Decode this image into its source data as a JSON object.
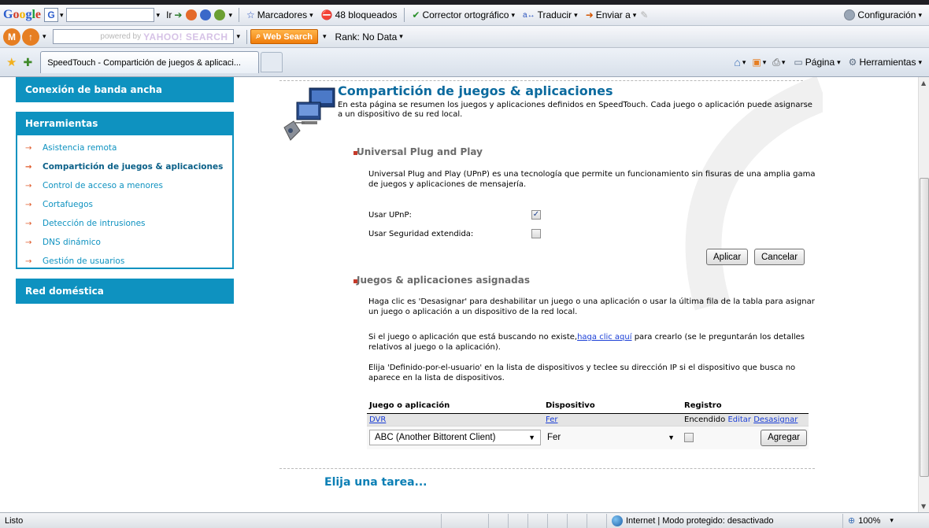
{
  "toolbar_google": {
    "logo": "Google",
    "go_label": "Ir",
    "bookmarks_label": "Marcadores",
    "blocked_label": "48 bloqueados",
    "spellcheck_label": "Corrector ortográfico",
    "translate_label": "Traducir",
    "send_label": "Enviar a",
    "settings_label": "Configuración"
  },
  "toolbar_yahoo": {
    "search_placeholder": "powered by",
    "search_brand": "YAHOO! SEARCH",
    "websearch_label": "Web Search",
    "rank_label": "Rank: No Data"
  },
  "tabs": {
    "active_tab_title": "SpeedTouch - Compartición de juegos & aplicaci...",
    "page_label": "Página",
    "tools_label": "Herramientas"
  },
  "sidebar": {
    "broadband_label": "Conexión de banda ancha",
    "tools_header": "Herramientas",
    "items": [
      {
        "label": "Asistencia remota",
        "active": false
      },
      {
        "label": "Compartición de juegos & aplicaciones",
        "active": true
      },
      {
        "label": "Control de acceso a menores",
        "active": false
      },
      {
        "label": "Cortafuegos",
        "active": false
      },
      {
        "label": "Detección de intrusiones",
        "active": false
      },
      {
        "label": "DNS dinámico",
        "active": false
      },
      {
        "label": "Gestión de usuarios",
        "active": false
      }
    ],
    "home_network_label": "Red doméstica"
  },
  "main": {
    "title": "Compartición de juegos & aplicaciones",
    "intro": "En esta página se resumen los juegos y aplicaciones definidos en SpeedTouch. Cada juego o aplicación puede asignarse a un dispositivo de su red local.",
    "upnp_header": "Universal Plug and Play",
    "upnp_desc": "Universal Plug and Play (UPnP) es una tecnología que permite un funcionamiento sin fisuras de una amplia gama de juegos y aplicaciones de mensajería.",
    "use_upnp_label": "Usar UPnP:",
    "use_upnp_checked": true,
    "extended_security_label": "Usar Seguridad extendida:",
    "extended_security_checked": false,
    "apply_label": "Aplicar",
    "cancel_label": "Cancelar",
    "assigned_header": "Juegos & aplicaciones asignadas",
    "assigned_desc": "Haga clic es 'Desasignar' para deshabilitar un juego o una aplicación o usar la última fila de la tabla para asignar un juego o aplicación a un dispositivo de la red local.",
    "notfound_before": "Si el juego o aplicación que está buscando no existe,",
    "notfound_link": "haga clic aquí",
    "notfound_after": " para crearlo (se le preguntarán los detalles relativos al juego o la aplicación).",
    "userdefined_desc": "Elija 'Definido-por-el-usuario' en la lista de dispositivos y teclee su dirección IP si el dispositivo que busca no aparece en la lista de dispositivos.",
    "table": {
      "headers": [
        "Juego o aplicación",
        "Dispositivo",
        "Registro"
      ],
      "rows": [
        {
          "game": "DVR",
          "device": "Fer",
          "log": "Encendido",
          "edit": "Editar",
          "unassign": "Desasignar"
        }
      ],
      "new_row": {
        "game_selected": "ABC (Another Bittorent Client)",
        "device_selected": "Fer",
        "log_checked": false,
        "add_label": "Agregar"
      }
    },
    "choose_task": "Elija una tarea..."
  },
  "statusbar": {
    "status_text": "Listo",
    "zone_text": "Internet | Modo protegido: desactivado",
    "zoom_text": "100%"
  }
}
